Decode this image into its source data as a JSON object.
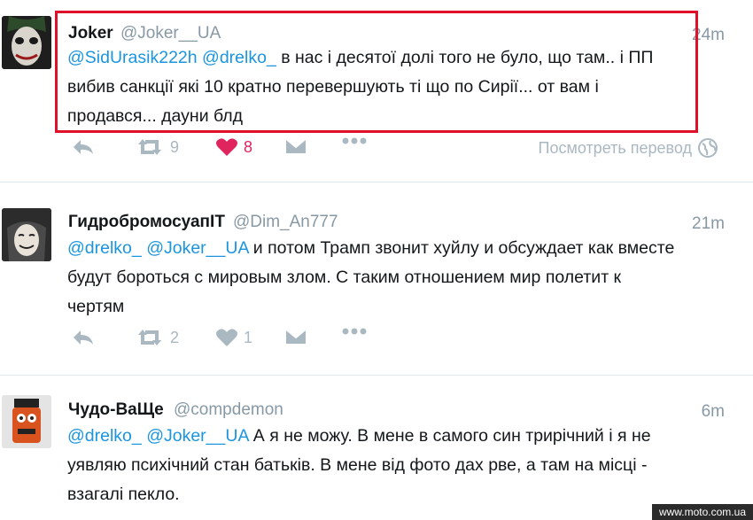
{
  "tweets": [
    {
      "name": "Joker",
      "handle": "@Joker__UA",
      "time": "24m",
      "mentions": [
        "@SidUrasik222h",
        "@drelko_"
      ],
      "text_line1": "в нас і десятої долі того не було, що там.. і ПП",
      "text_line2": "вибив санкції які 10 кратно перевершують ті що по Сирії... от вам і",
      "text_line3": "продався... дауни блд",
      "retweets": "9",
      "likes": "8",
      "translate": "Посмотреть перевод"
    },
    {
      "name": "ГидробромосуапIT",
      "handle": "@Dim_An777",
      "time": "21m",
      "mentions": [
        "@drelko_",
        "@Joker__UA"
      ],
      "text_line1": "и потом Трамп звонит хуйлу и  обсуждает как вместе",
      "text_line2": "будут бороться с мировым злом. С таким отношением мир полетит к",
      "text_line3": "чертям",
      "retweets": "2",
      "likes": "1"
    },
    {
      "name": "Чудо-ВаЩе",
      "handle": "@compdemon",
      "time": "6m",
      "mentions": [
        "@drelko_",
        "@Joker__UA"
      ],
      "text_line1": "А я не можу. В мене в самого син трирічний і я не",
      "text_line2": "уявляю психічний стан батьків. В мене від фото дах рве, а там на місці -",
      "text_line3": "взагалі пекло."
    }
  ],
  "watermark": "www.moto.com.ua",
  "colors": {
    "mention": "#1b95e0",
    "like": "#e0245e",
    "highlight": "#e0102a",
    "muted": "#8899a6"
  }
}
